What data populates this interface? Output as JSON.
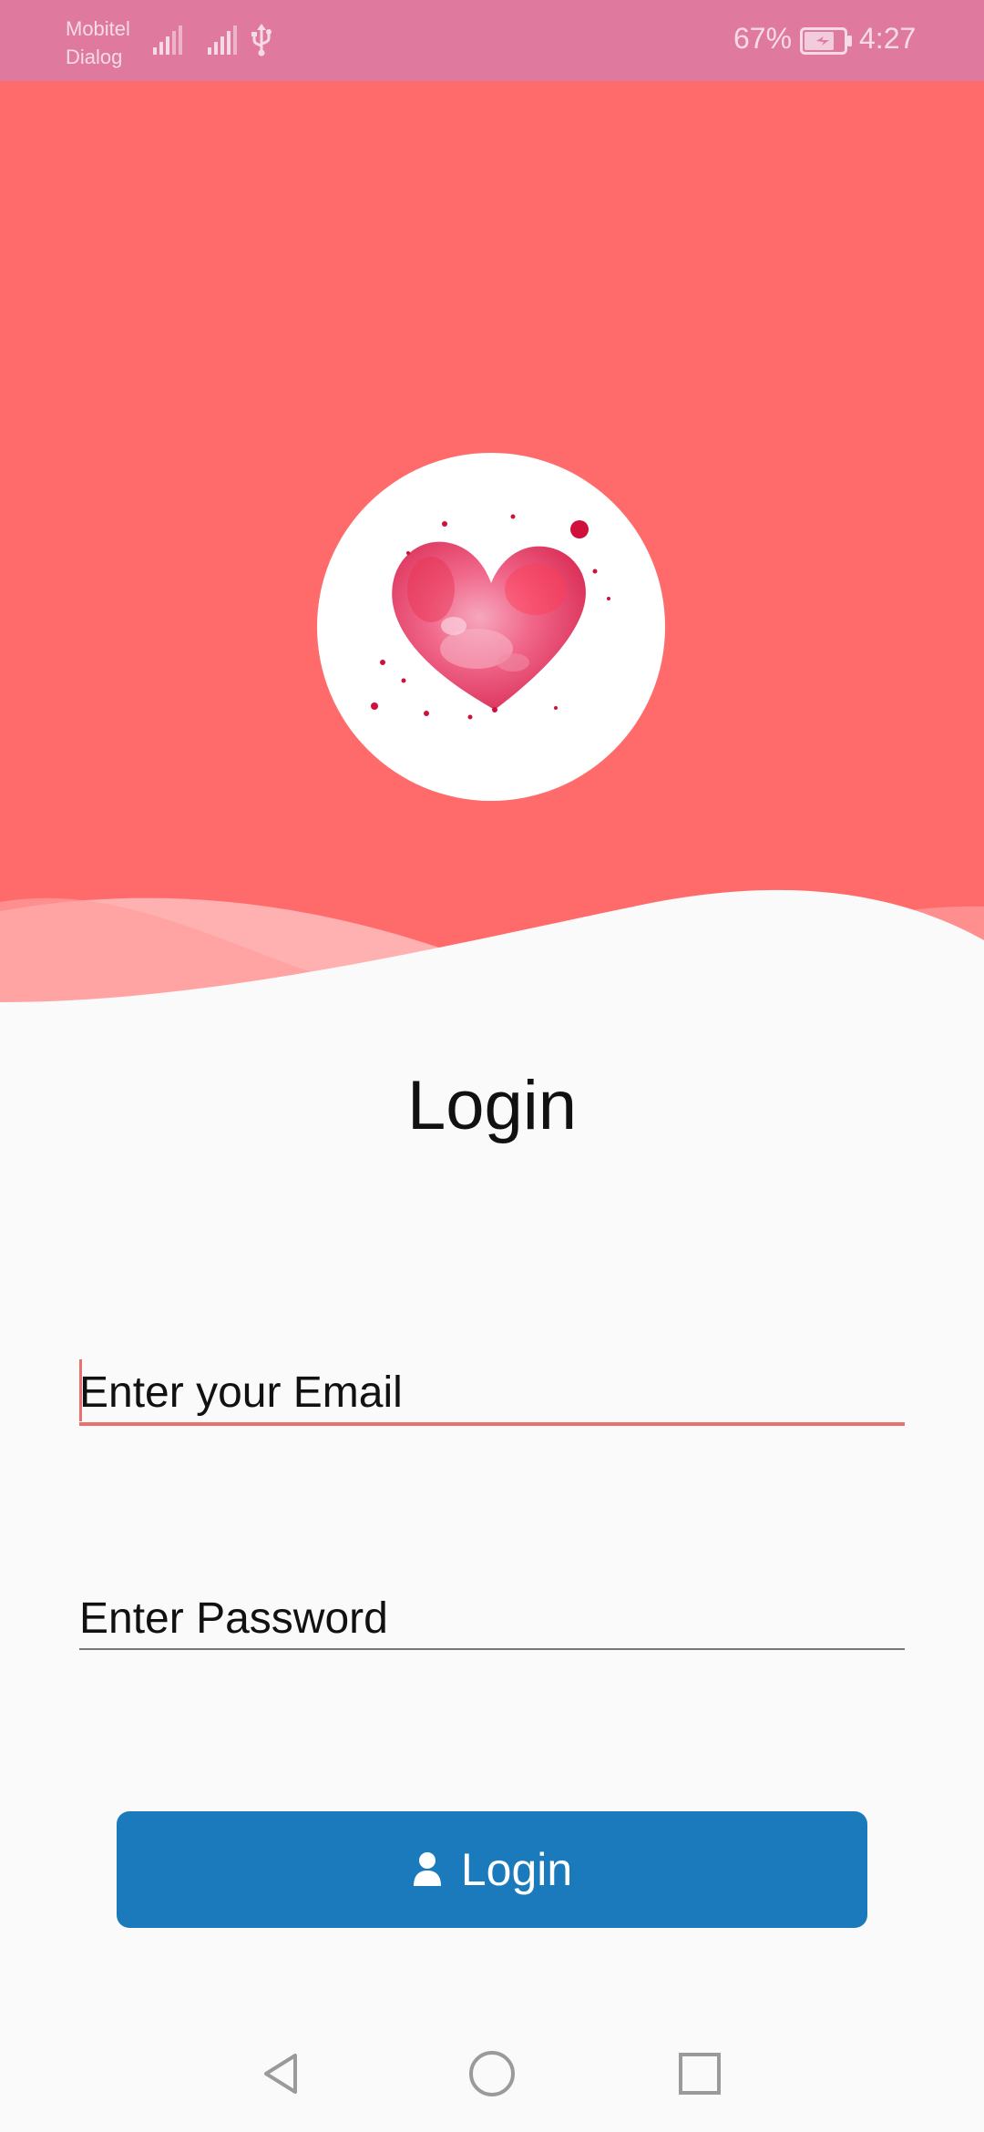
{
  "status_bar": {
    "carrier_line1": "Mobitel",
    "carrier_line2": "Dialog",
    "battery_percent": "67%",
    "time": "4:27",
    "icons": [
      "signal-icon",
      "signal-icon",
      "usb-icon",
      "battery-charging-icon"
    ]
  },
  "header": {
    "background_color": "#ff6b6b",
    "logo_icon": "watercolor-heart-icon"
  },
  "login": {
    "title": "Login",
    "email_placeholder": "Enter your Email",
    "password_placeholder": "Enter Password",
    "button_label": "Login",
    "button_icon": "user-icon",
    "button_color": "#1b7abb",
    "focus_color": "#e8706e"
  },
  "nav_bar": {
    "icons": [
      "back-icon",
      "home-icon",
      "recents-icon"
    ]
  }
}
